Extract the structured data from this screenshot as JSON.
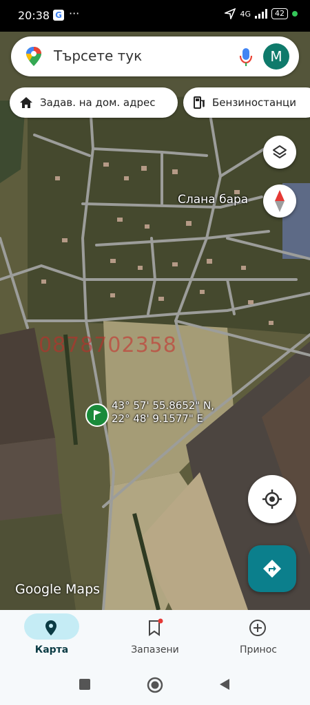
{
  "status_bar": {
    "time": "20:38",
    "network": "4G",
    "battery": "42",
    "more": "···"
  },
  "search": {
    "placeholder": "Търсете тук",
    "avatar_letter": "M"
  },
  "chips": [
    {
      "label": "Задав. на дом. адрес",
      "icon": "home-icon"
    },
    {
      "label": "Бензиностанци",
      "icon": "gas-station-icon"
    }
  ],
  "map": {
    "place_label": "Слана бара",
    "pin_coords_line1": "43° 57' 55.8652\" N,",
    "pin_coords_line2": "22° 48' 9.1577\" E",
    "watermark": "0878702358",
    "attribution": "Google Maps"
  },
  "bottom_nav": [
    {
      "label": "Карта",
      "icon": "explore-pin-icon",
      "active": true
    },
    {
      "label": "Запазени",
      "icon": "bookmark-icon",
      "active": false
    },
    {
      "label": "Принос",
      "icon": "add-circle-icon",
      "active": false
    }
  ],
  "colors": {
    "accent": "#0b7f8c",
    "avatar": "#0f7a6b",
    "nav_pill": "#c5ecf5",
    "pin_green": "#1a8a3a"
  }
}
